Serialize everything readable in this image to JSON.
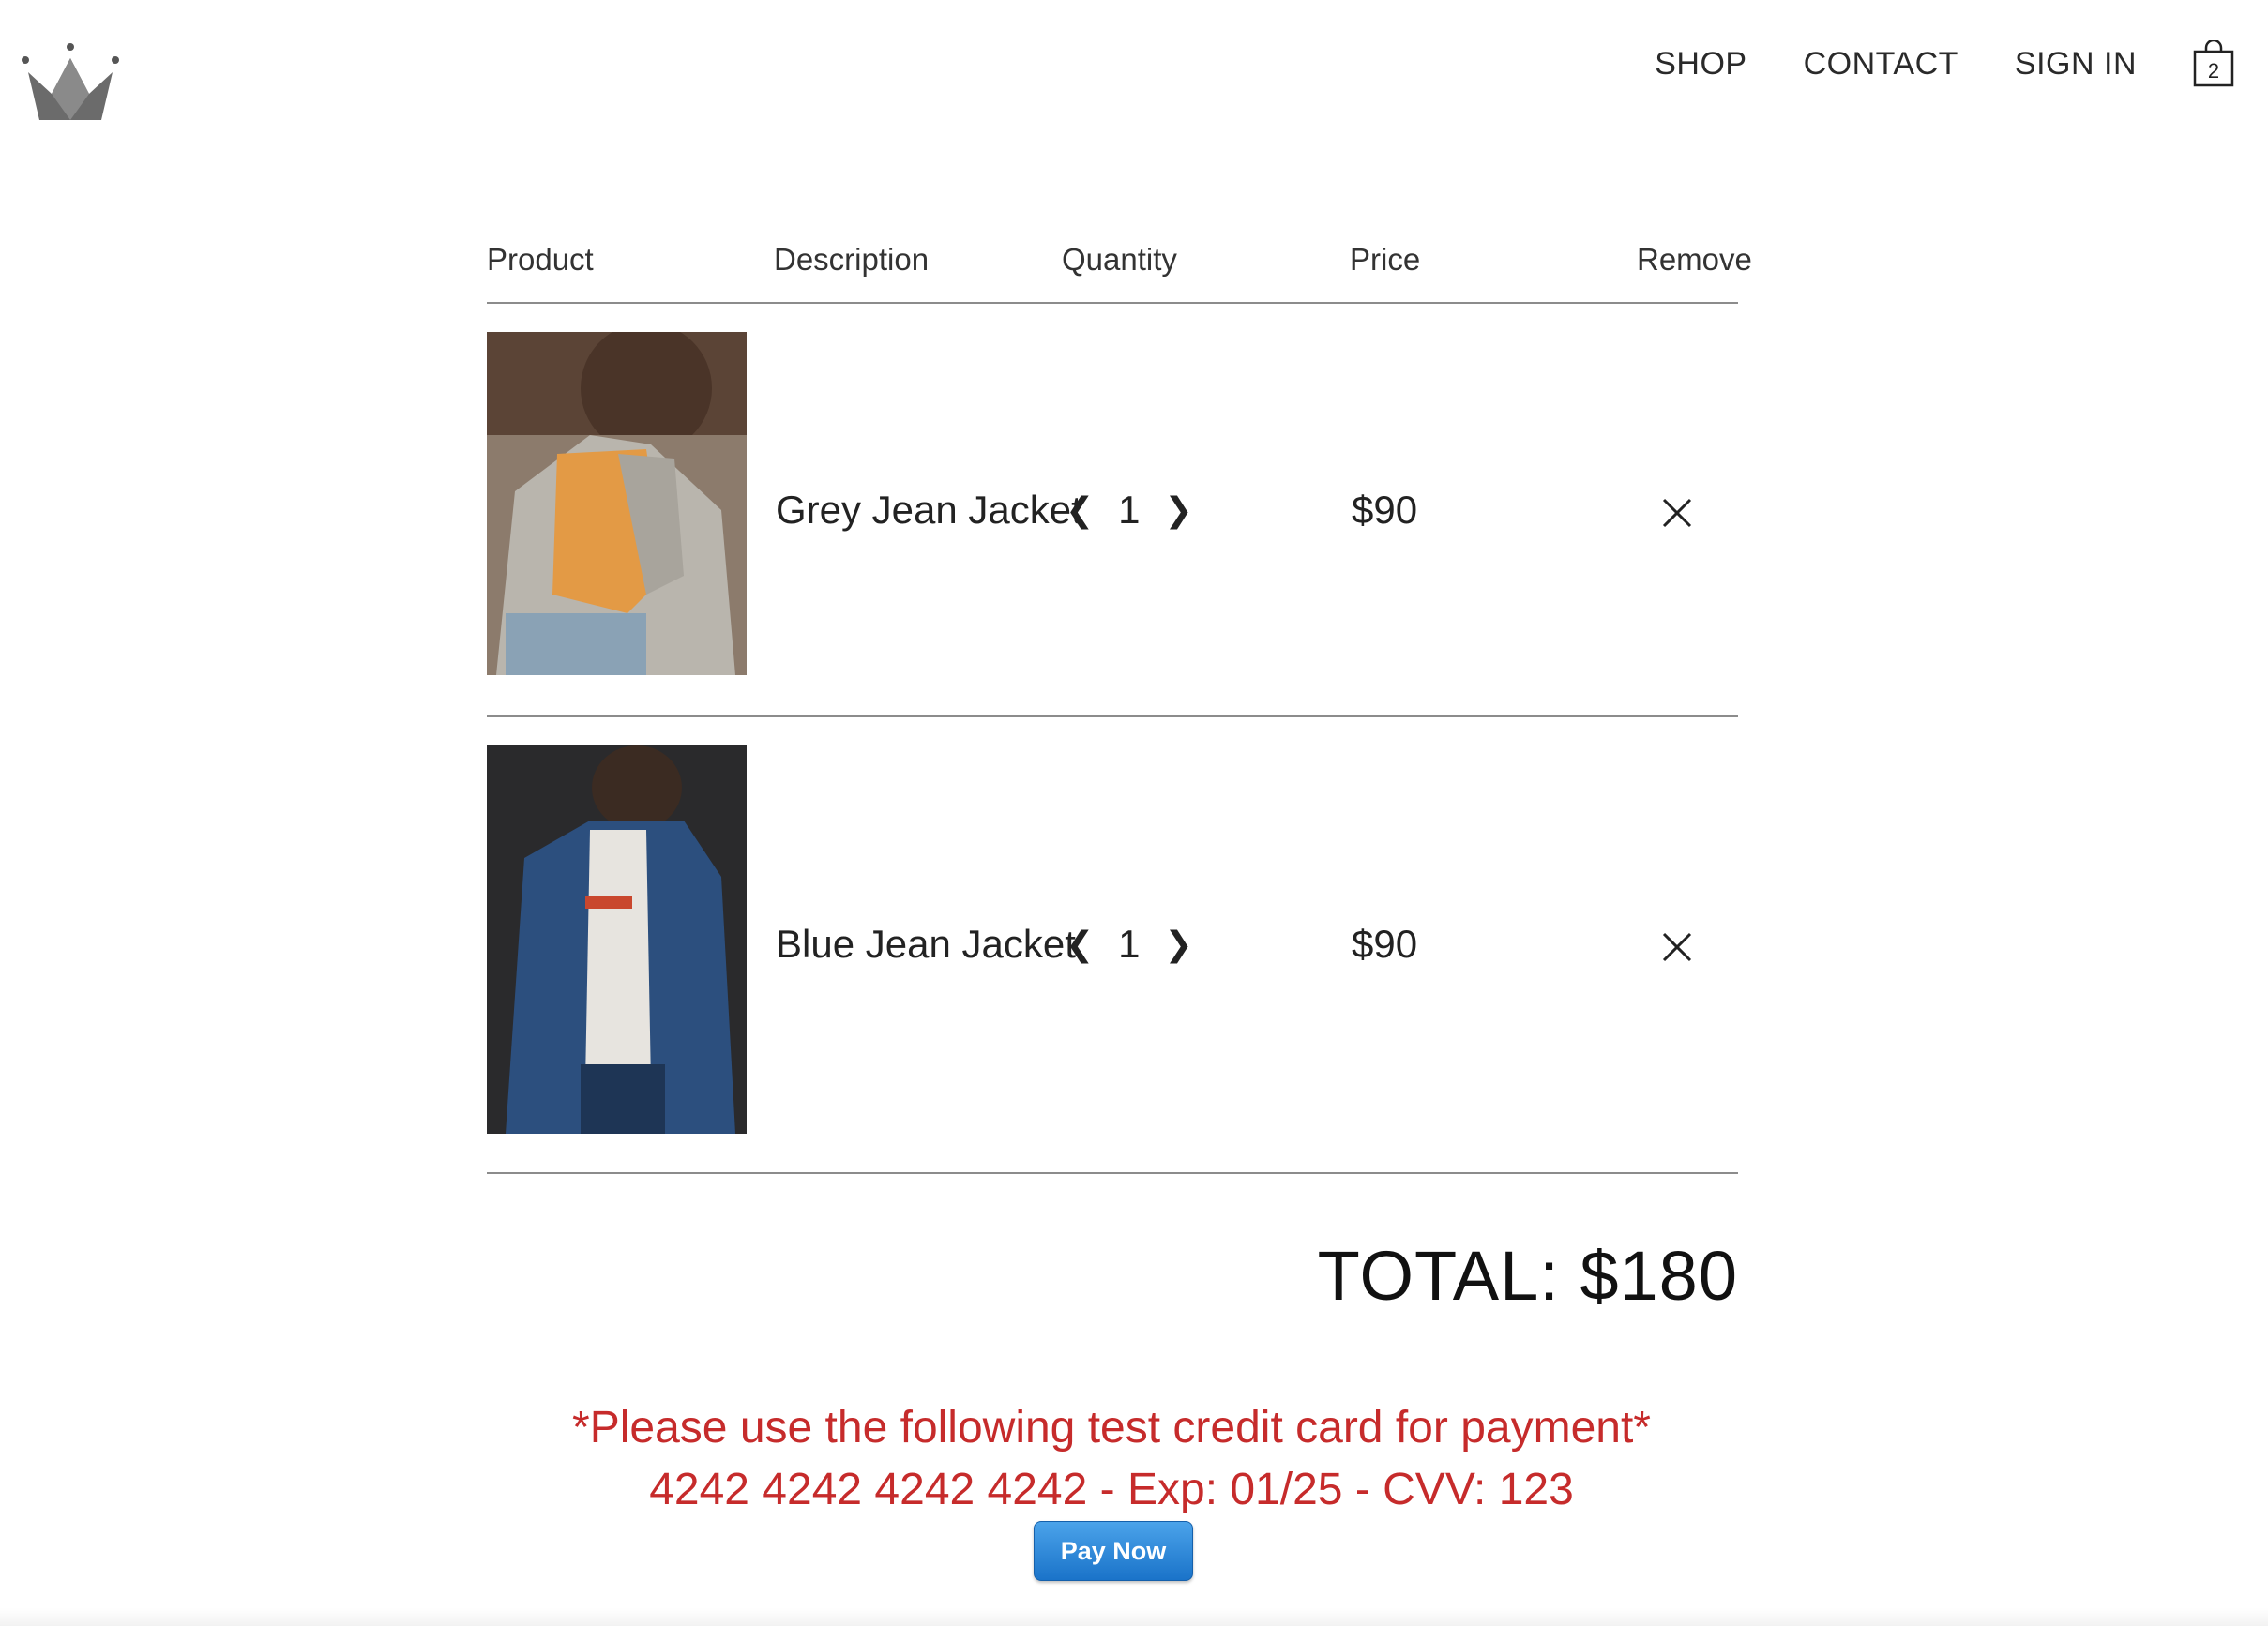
{
  "nav": {
    "items": [
      {
        "label": "SHOP"
      },
      {
        "label": "CONTACT"
      },
      {
        "label": "SIGN IN"
      }
    ],
    "cart_count": "2"
  },
  "table": {
    "headers": [
      "Product",
      "Description",
      "Quantity",
      "Price",
      "Remove"
    ]
  },
  "items": [
    {
      "description": "Grey Jean Jacket",
      "quantity": "1",
      "price": "$90",
      "image": "woman-in-grey-jean-jacket-photo"
    },
    {
      "description": "Blue Jean Jacket",
      "quantity": "1",
      "price": "$90",
      "image": "man-in-blue-jean-jacket-photo"
    }
  ],
  "total": "TOTAL: $180",
  "notice": {
    "line1": "*Please use the following test credit card for payment*",
    "line2": "4242 4242 4242 4242 - Exp: 01/25 - CVV: 123"
  },
  "pay_button": "Pay Now",
  "colors": {
    "notice": "#c62b2b",
    "pay_button": "#1a73c9"
  }
}
